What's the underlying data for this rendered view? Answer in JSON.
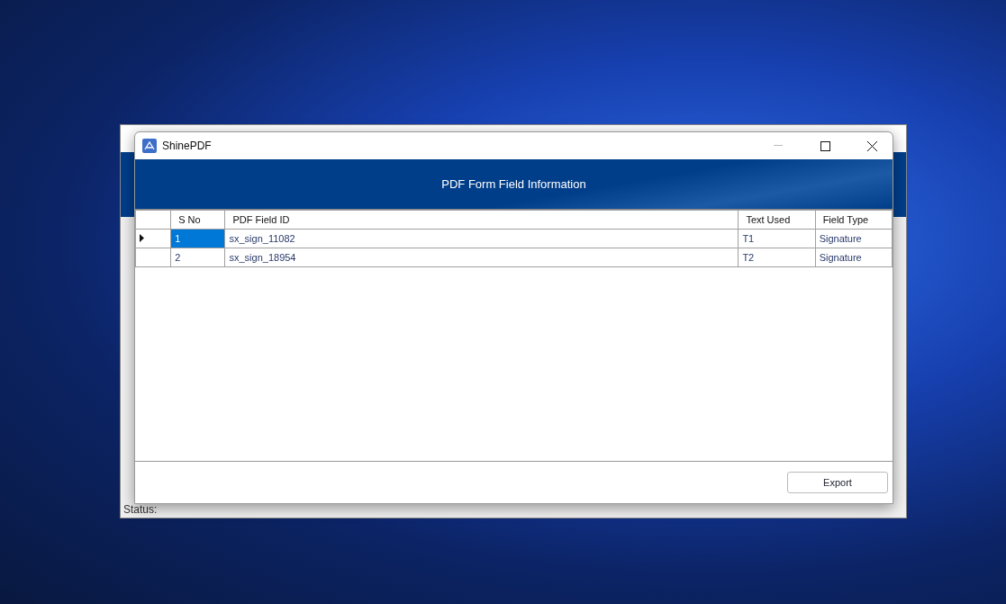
{
  "back_window": {
    "status_bar": "Status:"
  },
  "window": {
    "title": "ShinePDF"
  },
  "header": "PDF Form Field Information",
  "table": {
    "columns": [
      "S No",
      "PDF Field ID",
      "Text Used",
      "Field Type"
    ],
    "rows": [
      {
        "selected": true,
        "cells": [
          "1",
          "sx_sign_11082",
          "T1",
          "Signature"
        ]
      },
      {
        "selected": false,
        "cells": [
          "2",
          "sx_sign_18954",
          "T2",
          "Signature"
        ]
      }
    ]
  },
  "buttons": [
    "Export"
  ]
}
